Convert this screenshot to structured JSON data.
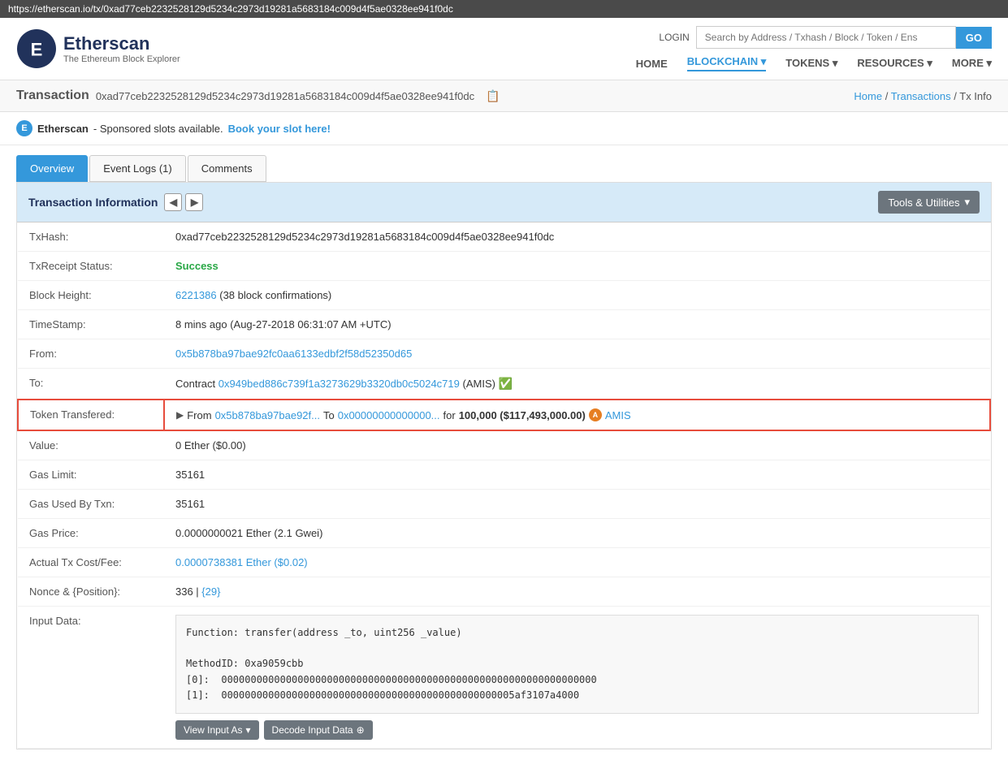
{
  "url_bar": {
    "url": "https://etherscan.io/tx/0xad77ceb2232528129d5234c2973d19281a5683184c009d4f5ae0328ee941f0dc"
  },
  "header": {
    "logo_name": "Etherscan",
    "logo_tagline": "The Ethereum Block Explorer",
    "login_label": "LOGIN",
    "search_placeholder": "Search by Address / Txhash / Block / Token / Ens",
    "search_btn": "GO",
    "nav": [
      {
        "label": "HOME",
        "active": false
      },
      {
        "label": "BLOCKCHAIN",
        "active": true,
        "has_arrow": true
      },
      {
        "label": "TOKENS",
        "active": false,
        "has_arrow": true
      },
      {
        "label": "RESOURCES",
        "active": false,
        "has_arrow": true
      },
      {
        "label": "MORE",
        "active": false,
        "has_arrow": true
      }
    ]
  },
  "breadcrumb": {
    "page_title": "Transaction",
    "tx_hash": "0xad77ceb2232528129d5234c2973d19281a5683184c009d4f5ae0328ee941f0dc",
    "home_label": "Home",
    "transactions_label": "Transactions",
    "current_label": "Tx Info"
  },
  "sponsor": {
    "logo_text": "E",
    "label": "Etherscan",
    "text": "- Sponsored slots available.",
    "link_label": "Book your slot here!"
  },
  "tabs": [
    {
      "label": "Overview",
      "active": true
    },
    {
      "label": "Event Logs (1)",
      "active": false
    },
    {
      "label": "Comments",
      "active": false
    }
  ],
  "tx_info": {
    "section_title": "Transaction Information",
    "tools_label": "Tools & Utilities",
    "fields": [
      {
        "label": "TxHash:",
        "value": "0xad77ceb2232528129d5234c2973d19281a5683184c009d4f5ae0328ee941f0dc",
        "type": "text"
      },
      {
        "label": "TxReceipt Status:",
        "value": "Success",
        "type": "success"
      },
      {
        "label": "Block Height:",
        "value_link": "6221386",
        "value_extra": "(38 block confirmations)",
        "type": "link_extra"
      },
      {
        "label": "TimeStamp:",
        "value": "8 mins ago (Aug-27-2018 06:31:07 AM +UTC)",
        "type": "text"
      },
      {
        "label": "From:",
        "value_link": "0x5b878ba97bae92fc0aa6133edbf2f58d52350d65",
        "type": "link"
      },
      {
        "label": "To:",
        "value_prefix": "Contract ",
        "value_link": "0x949bed886c739f1a3273629b3320db0c5024c719",
        "value_extra": " (AMIS)",
        "has_check": true,
        "type": "to"
      },
      {
        "label": "Token Transfered:",
        "type": "token_transfer",
        "from_link": "0x5b878ba97bae92f...",
        "to_link": "0x00000000000000...",
        "amount": "100,000 ($117,493,000.00)",
        "token_label": "AMIS"
      },
      {
        "label": "Value:",
        "value": "0 Ether ($0.00)",
        "type": "text"
      },
      {
        "label": "Gas Limit:",
        "value": "35161",
        "type": "text"
      },
      {
        "label": "Gas Used By Txn:",
        "value": "35161",
        "type": "text"
      },
      {
        "label": "Gas Price:",
        "value": "0.0000000021 Ether (2.1 Gwei)",
        "type": "text"
      },
      {
        "label": "Actual Tx Cost/Fee:",
        "value_link": "0.0000738381 Ether ($0.02)",
        "type": "link"
      },
      {
        "label": "Nonce & {Position}:",
        "value": "336 | ",
        "value_link": "{29}",
        "type": "nonce"
      },
      {
        "label": "Input Data:",
        "type": "input_data",
        "code": "Function: transfer(address _to, uint256 _value)\n\nMethodID: 0xa9059cbb\n[0]:  0000000000000000000000000000000000000000000000000000000000000000\n[1]:  00000000000000000000000000000000000000000000000005af3107a4000",
        "btn1": "View Input As",
        "btn2": "Decode Input Data"
      }
    ]
  }
}
